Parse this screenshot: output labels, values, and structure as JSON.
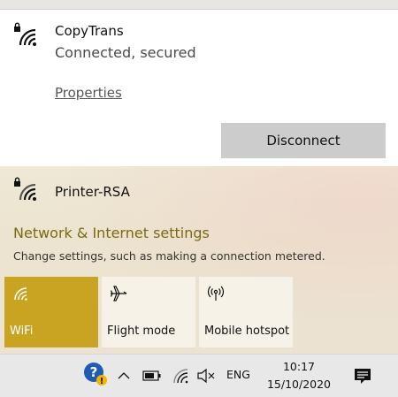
{
  "connected_network": {
    "name": "CopyTrans",
    "status": "Connected, secured",
    "properties_label": "Properties",
    "disconnect_label": "Disconnect"
  },
  "other_network": {
    "name": "Printer-RSA"
  },
  "settings": {
    "title": "Network & Internet settings",
    "description": "Change settings, such as making a connection metered."
  },
  "quick_actions": [
    {
      "label": "WiFi",
      "icon": "wifi-icon",
      "active": true
    },
    {
      "label": "Flight mode",
      "icon": "airplane-icon",
      "active": false
    },
    {
      "label": "Mobile hotspot",
      "icon": "hotspot-icon",
      "active": false
    }
  ],
  "taskbar": {
    "language": "ENG",
    "time": "10:17",
    "date": "15/10/2020"
  },
  "colors": {
    "accent": "#c9a422",
    "link": "#7a6a12"
  }
}
